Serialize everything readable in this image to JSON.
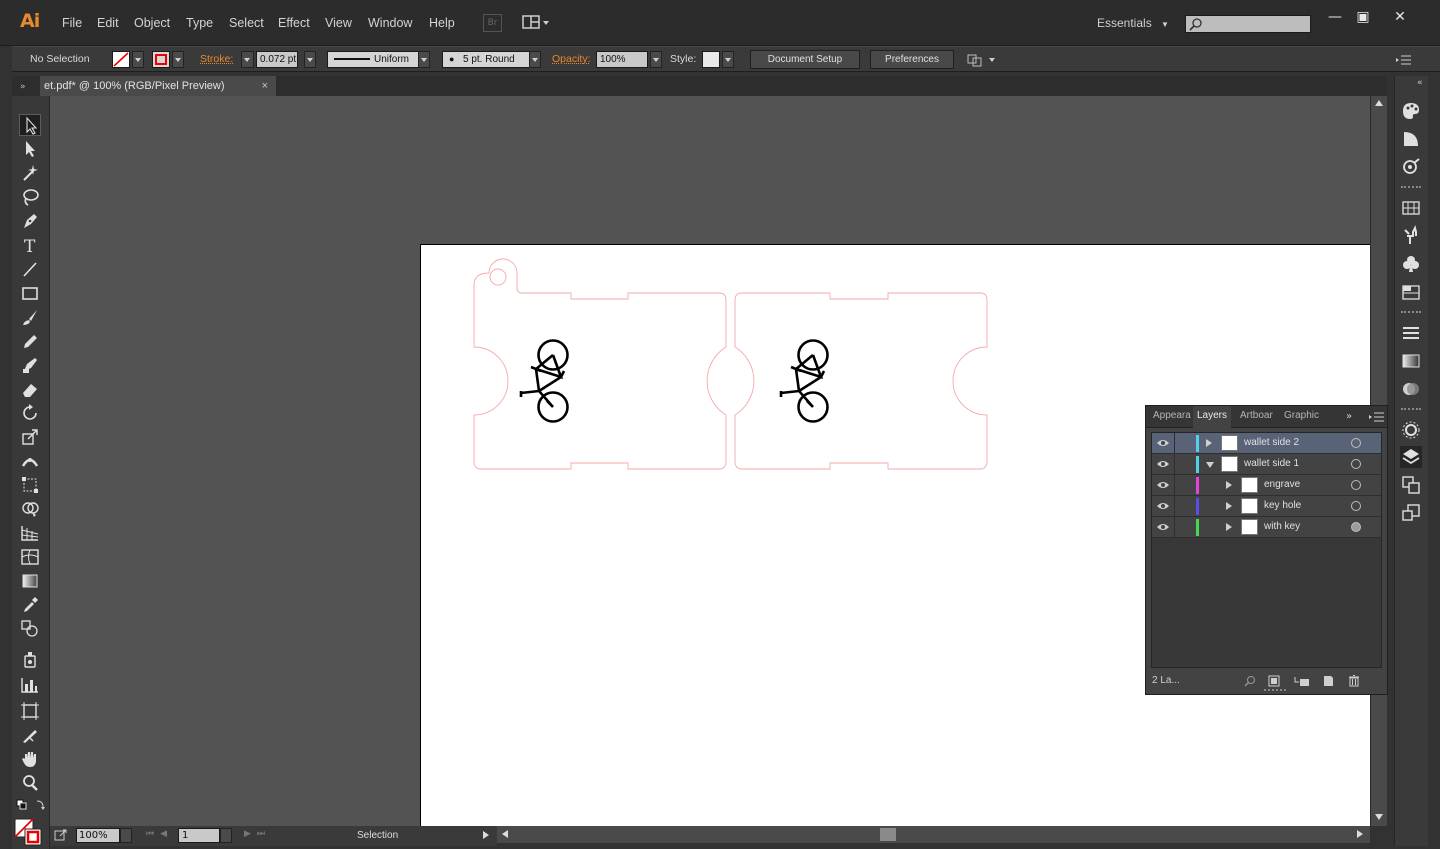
{
  "app": {
    "logo": "Ai"
  },
  "menu": [
    "File",
    "Edit",
    "Object",
    "Type",
    "Select",
    "Effect",
    "View",
    "Window",
    "Help"
  ],
  "bridge_badge": "Br",
  "workspace": "Essentials",
  "window_controls": {
    "minimize": "—",
    "restore": "▣",
    "close": "✕"
  },
  "control_bar": {
    "selection": "No Selection",
    "stroke_label": "Stroke:",
    "stroke_weight": "0.072 pt",
    "profile": "Uniform",
    "brush": "5 pt. Round",
    "opacity_label": "Opacity:",
    "opacity": "100%",
    "style_label": "Style:",
    "document_setup": "Document Setup",
    "preferences": "Preferences"
  },
  "document": {
    "tab_title": "et.pdf* @ 100% (RGB/Pixel Preview)",
    "close": "×"
  },
  "status": {
    "zoom": "100%",
    "artboard": "1",
    "tool": "Selection"
  },
  "layers_panel": {
    "tabs": [
      "Appeara",
      "Layers",
      "Artboar",
      "Graphic"
    ],
    "active_tab": "Layers",
    "count": "2 La...",
    "rows": [
      {
        "name": "wallet side 2",
        "color": "#4fd3e8",
        "level": 0,
        "expanded": false,
        "selected": true,
        "target": "empty"
      },
      {
        "name": "wallet side 1",
        "color": "#4fd3e8",
        "level": 0,
        "expanded": true,
        "selected": false,
        "target": "empty"
      },
      {
        "name": "engrave",
        "color": "#e542d8",
        "level": 1,
        "expanded": false,
        "selected": false,
        "target": "empty"
      },
      {
        "name": "key hole",
        "color": "#5a4fe0",
        "level": 1,
        "expanded": false,
        "selected": false,
        "target": "empty"
      },
      {
        "name": "with key",
        "color": "#45d855",
        "level": 1,
        "expanded": false,
        "selected": false,
        "target": "filled"
      }
    ]
  },
  "colors": {
    "accent": "#e8892f",
    "cut_line": "#f4a9a9",
    "selected_row": "#596378"
  }
}
